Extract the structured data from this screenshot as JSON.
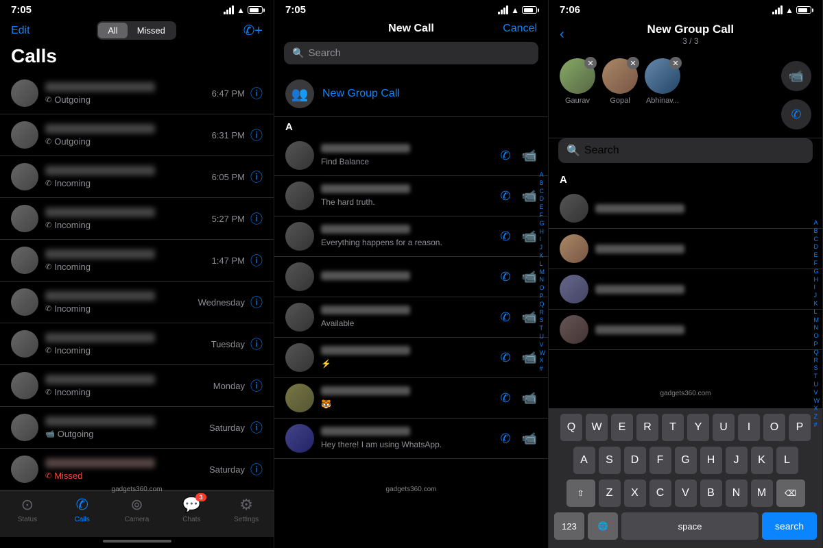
{
  "screens": [
    {
      "id": "calls",
      "statusBar": {
        "time": "7:05",
        "signal": 4,
        "wifi": true,
        "battery": 80
      },
      "header": {
        "editLabel": "Edit",
        "tabs": [
          "All",
          "Missed"
        ],
        "activeTab": "All"
      },
      "title": "Calls",
      "calls": [
        {
          "type": "Outgoing",
          "time": "6:47 PM",
          "missed": false
        },
        {
          "type": "Outgoing",
          "time": "6:31 PM",
          "missed": false
        },
        {
          "type": "Incoming",
          "time": "6:05 PM",
          "missed": false
        },
        {
          "type": "Incoming",
          "time": "5:27 PM",
          "missed": false
        },
        {
          "type": "Incoming",
          "time": "1:47 PM",
          "missed": false
        },
        {
          "type": "Incoming",
          "time": "Wednesday",
          "missed": false
        },
        {
          "type": "Incoming",
          "time": "Tuesday",
          "missed": false
        },
        {
          "type": "Incoming",
          "time": "Monday",
          "missed": false
        },
        {
          "type": "Outgoing",
          "time": "Saturday",
          "missed": false,
          "video": true
        },
        {
          "type": "Missed",
          "time": "Saturday",
          "missed": true
        }
      ],
      "tabBar": {
        "items": [
          {
            "icon": "⊙",
            "label": "Status",
            "active": false
          },
          {
            "icon": "✆",
            "label": "Calls",
            "active": true
          },
          {
            "icon": "⊚",
            "label": "Camera",
            "active": false
          },
          {
            "icon": "💬",
            "label": "Chats",
            "active": false,
            "badge": "3"
          },
          {
            "icon": "⚙",
            "label": "Settings",
            "active": false
          }
        ]
      },
      "watermark": "gadgets360.com"
    },
    {
      "id": "newcall",
      "statusBar": {
        "time": "7:05",
        "signal": 4,
        "wifi": true,
        "battery": 80
      },
      "header": {
        "title": "New Call",
        "cancelLabel": "Cancel"
      },
      "searchPlaceholder": "Search",
      "newGroupCall": "New Group Call",
      "sectionLabel": "A",
      "contacts": [
        {
          "status": "Find Balance"
        },
        {
          "status": "The hard truth."
        },
        {
          "status": "Everything happens for a reason."
        },
        {
          "status": ""
        },
        {
          "status": "Available"
        },
        {
          "status": ""
        },
        {
          "status": "🐯"
        },
        {
          "status": "Hey there! I am using WhatsApp."
        },
        {
          "status": ""
        }
      ],
      "alphabetIndex": [
        "A",
        "B",
        "C",
        "D",
        "E",
        "F",
        "G",
        "H",
        "I",
        "J",
        "K",
        "L",
        "M",
        "N",
        "O",
        "P",
        "Q",
        "R",
        "S",
        "T",
        "U",
        "V",
        "W",
        "X",
        "#"
      ],
      "watermark": "gadgets360.com"
    },
    {
      "id": "newgroupcall",
      "statusBar": {
        "time": "7:06",
        "signal": 4,
        "wifi": true,
        "battery": 80
      },
      "header": {
        "title": "New Group Call",
        "subtitle": "3 / 3",
        "backLabel": "‹"
      },
      "searchPlaceholder": "Search",
      "selectedContacts": [
        {
          "name": "Gaurav"
        },
        {
          "name": "Gopal"
        },
        {
          "name": "Abhinav..."
        }
      ],
      "sectionLabel": "A",
      "contacts": [
        {},
        {},
        {},
        {}
      ],
      "alphabetIndex": [
        "A",
        "B",
        "C",
        "D",
        "E",
        "F",
        "G",
        "H",
        "I",
        "J",
        "K",
        "L",
        "M",
        "N",
        "O",
        "P",
        "Q",
        "R",
        "S",
        "T",
        "U",
        "V",
        "W",
        "X",
        "Z",
        "#"
      ],
      "keyboard": {
        "rows": [
          [
            "Q",
            "W",
            "E",
            "R",
            "T",
            "Y",
            "U",
            "I",
            "O",
            "P"
          ],
          [
            "A",
            "S",
            "D",
            "F",
            "G",
            "H",
            "J",
            "K",
            "L"
          ],
          [
            "Z",
            "X",
            "C",
            "V",
            "B",
            "N",
            "M"
          ]
        ],
        "bottomRow": {
          "num": "123",
          "emoji": "🙂",
          "space": "space",
          "search": "search"
        }
      },
      "watermark": "gadgets360.com"
    }
  ]
}
